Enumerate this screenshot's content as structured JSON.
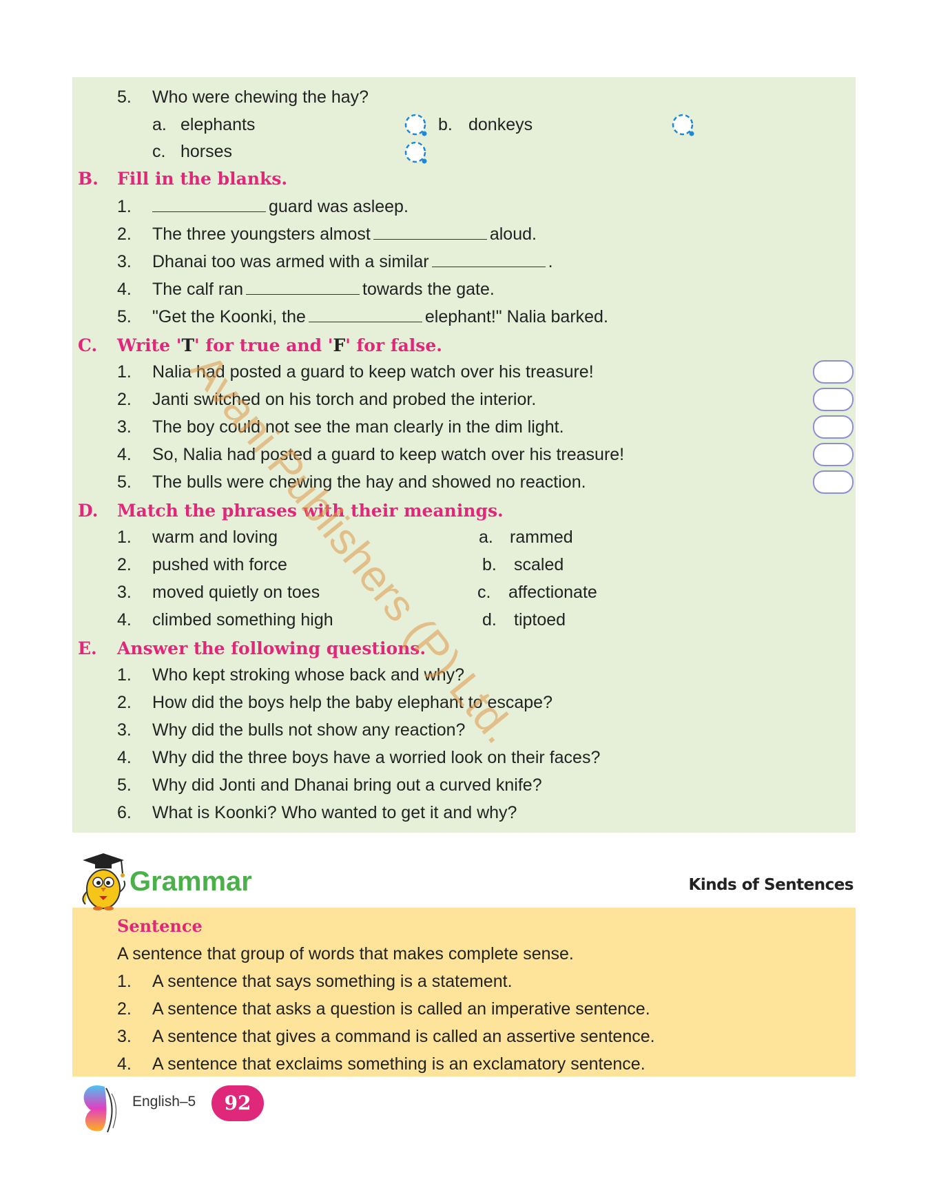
{
  "sectionA_tail": {
    "q_num": "5.",
    "question": "Who were chewing the hay?",
    "options": [
      {
        "label": "a.",
        "text": "elephants"
      },
      {
        "label": "b.",
        "text": "donkeys"
      },
      {
        "label": "c.",
        "text": "horses"
      }
    ]
  },
  "sectionB": {
    "letter": "B.",
    "title": "Fill in the blanks.",
    "items": [
      {
        "num": "1.",
        "before": "",
        "after": "guard was asleep."
      },
      {
        "num": "2.",
        "before": "The three youngsters almost",
        "after": "aloud."
      },
      {
        "num": "3.",
        "before": "Dhanai too was armed with a similar",
        "after": "."
      },
      {
        "num": "4.",
        "before": "The calf ran",
        "after": "towards the gate."
      },
      {
        "num": "5.",
        "before": "\"Get the Koonki, the",
        "after": "elephant!\" Nalia barked."
      }
    ]
  },
  "sectionC": {
    "letter": "C.",
    "title_parts": [
      "Write '",
      "T",
      "' for true and '",
      "F",
      "' for false."
    ],
    "items": [
      {
        "num": "1.",
        "text": "Nalia had posted a guard to keep watch over his treasure!"
      },
      {
        "num": "2.",
        "text": "Janti switched on his torch and probed the interior."
      },
      {
        "num": "3.",
        "text": "The boy could not see the man clearly in the dim light."
      },
      {
        "num": "4.",
        "text": "So, Nalia had posted a guard to keep watch over his treasure!"
      },
      {
        "num": "5.",
        "text": "The bulls were chewing the hay and showed no reaction."
      }
    ]
  },
  "sectionD": {
    "letter": "D.",
    "title": "Match the phrases with their meanings.",
    "left": [
      {
        "num": "1.",
        "text": "warm and loving"
      },
      {
        "num": "2.",
        "text": "pushed with force"
      },
      {
        "num": "3.",
        "text": "moved quietly on toes"
      },
      {
        "num": "4.",
        "text": "climbed something high"
      }
    ],
    "right": [
      {
        "label": "a.",
        "text": "rammed"
      },
      {
        "label": "b.",
        "text": "scaled"
      },
      {
        "label": "c.",
        "text": "affectionate"
      },
      {
        "label": "d.",
        "text": "tiptoed"
      }
    ]
  },
  "sectionE": {
    "letter": "E.",
    "title": "Answer the following questions.",
    "items": [
      {
        "num": "1.",
        "text": "Who kept stroking whose back and why?"
      },
      {
        "num": "2.",
        "text": "How did the boys help the baby elephant to escape?"
      },
      {
        "num": "3.",
        "text": "Why did the bulls not show any reaction?"
      },
      {
        "num": "4.",
        "text": "Why did the three boys have a worried look on their faces?"
      },
      {
        "num": "5.",
        "text": "Why did Jonti and Dhanai bring out a curved knife?"
      },
      {
        "num": "6.",
        "text": "What is Koonki? Who wanted to get it and why?"
      }
    ]
  },
  "watermark": "Avani Publishers (P) Ltd.",
  "grammar": {
    "title": "Grammar",
    "subtitle": "Kinds of Sentences",
    "sentence_heading": "Sentence",
    "definition": "A sentence that group of words that makes complete sense.",
    "items": [
      {
        "num": "1.",
        "text": "A sentence that says something is a statement."
      },
      {
        "num": "2.",
        "text": "A sentence that asks a question is called an imperative sentence."
      },
      {
        "num": "3.",
        "text": "A sentence that gives a command is called an assertive sentence."
      },
      {
        "num": "4.",
        "text": "A sentence that exclaims something is an exclamatory sentence."
      }
    ]
  },
  "footer": {
    "book": "English–5",
    "page": "92"
  },
  "colors": {
    "heading_pink": "#e0287a",
    "grammar_green": "#4cb04a",
    "panel_green": "#e6f0d9",
    "panel_yellow": "#fde49a",
    "watermark": "#de9646"
  }
}
